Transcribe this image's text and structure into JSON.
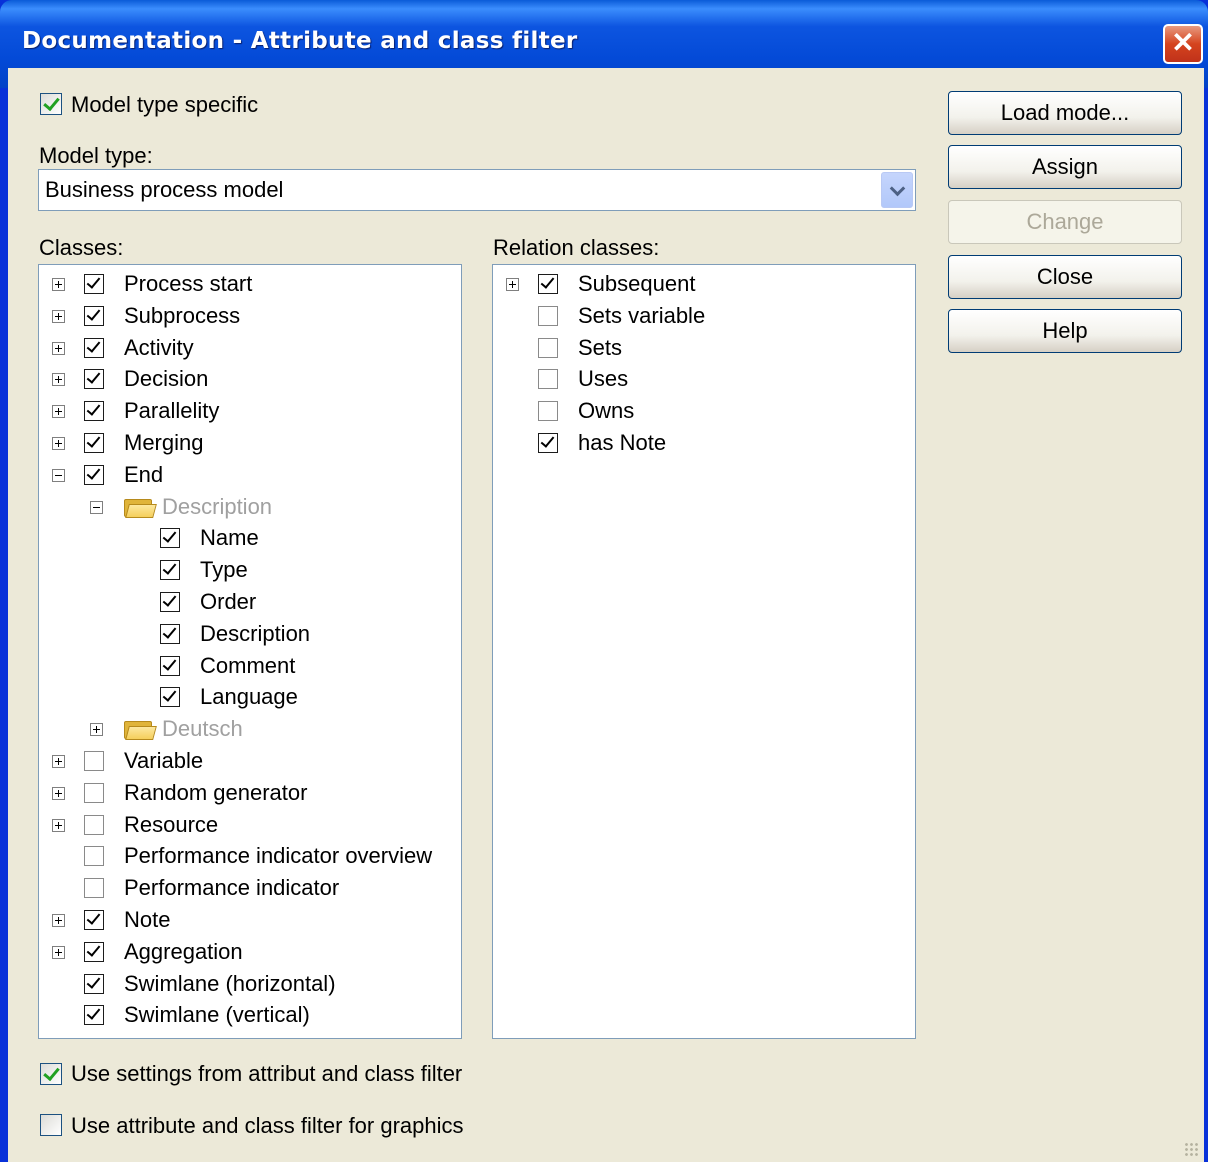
{
  "window": {
    "title": "Documentation - Attribute and class filter",
    "close_glyph": "✕"
  },
  "model_type_specific": {
    "label": "Model type specific",
    "checked": true
  },
  "model_type": {
    "label": "Model type:",
    "value": "Business process model"
  },
  "classes": {
    "label": "Classes:",
    "items": [
      {
        "label": "Process start",
        "expander": "plus",
        "checked": true
      },
      {
        "label": "Subprocess",
        "expander": "plus",
        "checked": true
      },
      {
        "label": "Activity",
        "expander": "plus",
        "checked": true
      },
      {
        "label": "Decision",
        "expander": "plus",
        "checked": true
      },
      {
        "label": "Parallelity",
        "expander": "plus",
        "checked": true
      },
      {
        "label": "Merging",
        "expander": "plus",
        "checked": true
      },
      {
        "label": "End",
        "expander": "minus",
        "checked": true
      },
      {
        "label": "Description",
        "folder": true,
        "expander": "minus",
        "level": 1
      },
      {
        "label": "Name",
        "checked": true,
        "level": 2
      },
      {
        "label": "Type",
        "checked": true,
        "level": 2
      },
      {
        "label": "Order",
        "checked": true,
        "level": 2
      },
      {
        "label": "Description",
        "checked": true,
        "level": 2
      },
      {
        "label": "Comment",
        "checked": true,
        "level": 2
      },
      {
        "label": "Language",
        "checked": true,
        "level": 2
      },
      {
        "label": "Deutsch",
        "folder": true,
        "expander": "plus",
        "level": 1
      },
      {
        "label": "Variable",
        "expander": "plus",
        "checked": false
      },
      {
        "label": "Random generator",
        "expander": "plus",
        "checked": false
      },
      {
        "label": "Resource",
        "expander": "plus",
        "checked": false
      },
      {
        "label": "Performance indicator overview",
        "checked": false
      },
      {
        "label": "Performance indicator",
        "checked": false
      },
      {
        "label": "Note",
        "expander": "plus",
        "checked": true
      },
      {
        "label": "Aggregation",
        "expander": "plus",
        "checked": true
      },
      {
        "label": "Swimlane (horizontal)",
        "checked": true
      },
      {
        "label": "Swimlane (vertical)",
        "checked": true
      }
    ]
  },
  "relation_classes": {
    "label": "Relation classes:",
    "items": [
      {
        "label": "Subsequent",
        "expander": "plus",
        "checked": true
      },
      {
        "label": "Sets variable",
        "checked": false
      },
      {
        "label": "Sets",
        "checked": false
      },
      {
        "label": "Uses",
        "checked": false
      },
      {
        "label": "Owns",
        "checked": false
      },
      {
        "label": "has Note",
        "checked": true
      }
    ]
  },
  "buttons": {
    "load_mode": "Load mode...",
    "assign": "Assign",
    "change": "Change",
    "close": "Close",
    "help": "Help"
  },
  "bottom_options": {
    "use_settings": {
      "label": "Use settings from attribut and class filter",
      "checked": true
    },
    "use_for_graphics": {
      "label": "Use attribute and class filter for graphics",
      "checked": false
    }
  },
  "colors": {
    "title_bar": "#0349d6",
    "dialog_bg": "#ece9d8",
    "check_green": "#21a121"
  }
}
